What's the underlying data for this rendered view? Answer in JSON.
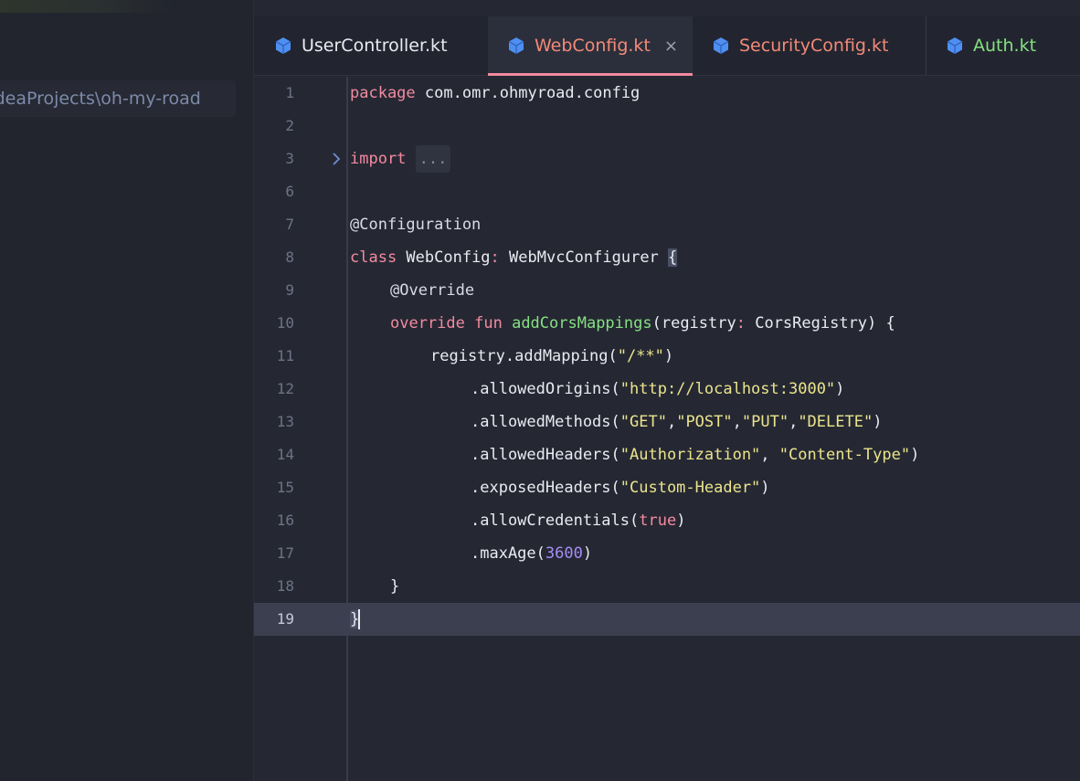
{
  "sidebar": {
    "project_path": "IdeaProjects\\oh-my-road"
  },
  "colors": {
    "keyword": "#f38aa0",
    "string": "#ebe48c",
    "number": "#a68df7",
    "function": "#86e081",
    "accent": "#f38aa0",
    "file_icon": "#4f8ff2"
  },
  "tabs": [
    {
      "label": "UserController.kt",
      "icon": "kotlin-file-icon",
      "color": "#e9ebf1"
    },
    {
      "label": "WebConfig.kt",
      "icon": "kotlin-file-icon",
      "color": "#f38a78",
      "active": true
    },
    {
      "label": "SecurityConfig.kt",
      "icon": "kotlin-file-icon",
      "color": "#f38a78"
    },
    {
      "label": "Auth.kt",
      "icon": "kotlin-file-icon",
      "color": "#86e081"
    }
  ],
  "tab_close_label": "×",
  "editor": {
    "line_numbers": [
      "1",
      "2",
      "3",
      "6",
      "7",
      "8",
      "9",
      "10",
      "11",
      "12",
      "13",
      "14",
      "15",
      "16",
      "17",
      "18",
      "19"
    ],
    "current_line": "19",
    "code": {
      "l1_kw": "package",
      "l1_rest": " com.omr.ohmyroad.config",
      "l3_kw": "import",
      "l3_fold": "...",
      "l7": "@Configuration",
      "l8_kw": "class",
      "l8_name": " WebConfig",
      "l8_colon": ":",
      "l8_type": " WebMvcConfigurer ",
      "l8_brace": "{",
      "l9": "@Override",
      "l10_kw1": "override",
      "l10_kw2": " fun ",
      "l10_fn": "addCorsMappings",
      "l10_p1": "(registry",
      "l10_colon": ":",
      "l10_p2": " CorsRegistry) {",
      "l11_a": "registry.addMapping(",
      "l11_s": "\"/**\"",
      "l11_b": ")",
      "l12_a": ".allowedOrigins(",
      "l12_s": "\"http://localhost:3000\"",
      "l12_b": ")",
      "l13_a": ".allowedMethods(",
      "l13_s1": "\"GET\"",
      "l13_s2": "\"POST\"",
      "l13_s3": "\"PUT\"",
      "l13_s4": "\"DELETE\"",
      "l13_b": ")",
      "l14_a": ".allowedHeaders(",
      "l14_s1": "\"Authorization\"",
      "l14_s2": "\"Content-Type\"",
      "l14_b": ")",
      "l15_a": ".exposedHeaders(",
      "l15_s": "\"Custom-Header\"",
      "l15_b": ")",
      "l16_a": ".allowCredentials(",
      "l16_v": "true",
      "l16_b": ")",
      "l17_a": ".maxAge(",
      "l17_v": "3600",
      "l17_b": ")",
      "l18": "}",
      "l19": "}"
    }
  }
}
